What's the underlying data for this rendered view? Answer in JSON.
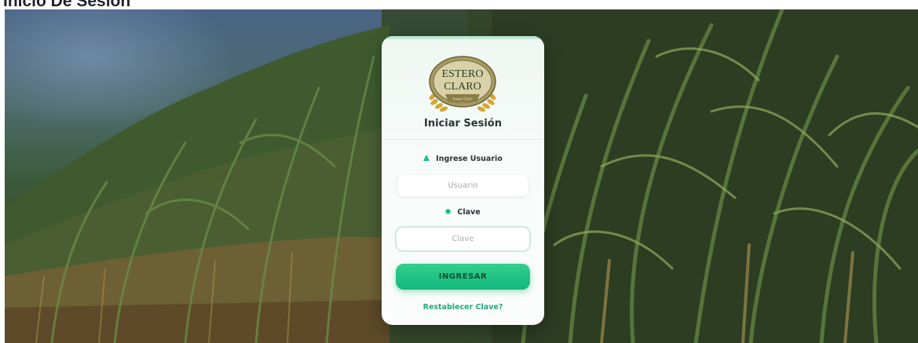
{
  "page": {
    "heading": "Inicio De Sesión"
  },
  "login": {
    "logo": {
      "line1": "ESTERO",
      "line2": "CLARO",
      "ribbon": "Estero Claro"
    },
    "title": "Iniciar Sesión",
    "user_label": "Ingrese Usuario",
    "user_placeholder": "Usuario",
    "user_icon": "user-icon",
    "pass_label": "Clave",
    "pass_placeholder": "Clave",
    "pass_icon": "key-icon",
    "submit_label": "INGRESAR",
    "reset_link": "Restablecer Clave?"
  },
  "colors": {
    "accent": "#1cc083",
    "accent_text": "#25a878"
  }
}
